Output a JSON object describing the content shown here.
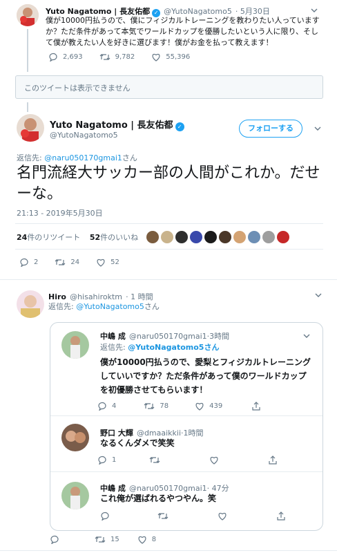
{
  "tweet1": {
    "name": "Yuto Nagatomo | 長友佑都",
    "handle": "@YutoNagatomo5",
    "date": "· 5月30日",
    "text": "僕が10000円払うので、僕にフィジカルトレーニングを教わりたい人っていますか？ただ条件があって本気でワールドカップを優勝したいという人に限り、そして僕が教えたい人を好きに選びます！僕がお金を払って教えます！",
    "replies": "2,693",
    "retweets": "9,782",
    "likes": "55,396"
  },
  "unavailable": "このツイートは表示できません",
  "main": {
    "name": "Yuto Nagatomo | 長友佑都",
    "handle": "@YutoNagatomo5",
    "follow_label": "フォローする",
    "reply_prefix": "返信先:",
    "reply_to": "@naru050170gmai1",
    "reply_suffix": "さん",
    "text": "名門流経大サッカー部の人間がこれか。だせーな。",
    "timestamp": "21:13 - 2019年5月30日",
    "rt_count": "24",
    "rt_label": "件のリツイート",
    "like_count": "52",
    "like_label": "件のいいね",
    "replies": "2",
    "retweets": "24",
    "likes": "52"
  },
  "reply": {
    "name": "Hiro",
    "handle": "@hisahiroktm",
    "time": "· 1 時間",
    "reply_prefix": "返信先:",
    "reply_to": "@YutoNagatomo5",
    "reply_suffix": "さん",
    "retweets": "15",
    "likes": "8"
  },
  "quoted": [
    {
      "name": "中嶋 成",
      "handle": "@naru050170gmai1",
      "time": "·3時間",
      "reply_prefix": "返信先:",
      "reply_to": "@YutoNagatomo5さん",
      "text": "僕が10000円払うので、愛梨とフィジカルトレーニングしていいですか？ただ条件があって僕のワールドカップを初優勝させてもらいます！",
      "replies": "4",
      "retweets": "78",
      "likes": "439"
    },
    {
      "name": "野口 大輝",
      "handle": "@dmaaikkii",
      "time": "·1時間",
      "text": "なるくんダメで笑笑",
      "replies": "1"
    },
    {
      "name": "中嶋 成",
      "handle": "@naru050170gmai1",
      "time": "· 47分",
      "text": "これ俺が選ばれるやつやん。笑"
    }
  ],
  "colors": {
    "accent": "#1da1f2",
    "link": "#1b95e0",
    "muted": "#657786",
    "border": "#e6ecf0"
  }
}
